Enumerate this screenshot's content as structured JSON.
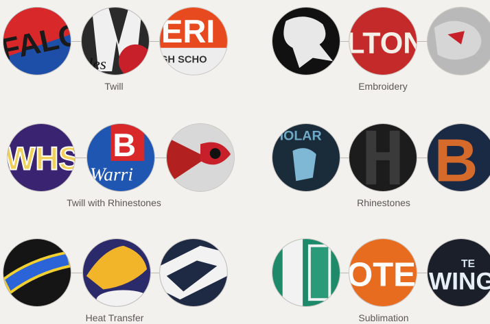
{
  "categories": [
    {
      "label": "Twill"
    },
    {
      "label": "Embroidery"
    },
    {
      "label": "Twill with Rhinestones"
    },
    {
      "label": "Rhinestones"
    },
    {
      "label": "Heat Transfer"
    },
    {
      "label": "Sublimation"
    }
  ],
  "colors": {
    "background": "#f3f1ee",
    "caption": "#5a5755",
    "connector": "#b9b5b0"
  },
  "swatches": {
    "twill_1": "FALC",
    "twill_2": "les",
    "twill_3a": "ERI",
    "twill_3b": "GH SCHO",
    "emb_2": "LTON",
    "twr_1": "WHS",
    "twr_2a": "B",
    "twr_2b": "Warri",
    "rh_1": "HOLAR",
    "rh_3": "B",
    "sub_2": "OTE",
    "sub_3a": "TE",
    "sub_3b": "WING"
  }
}
